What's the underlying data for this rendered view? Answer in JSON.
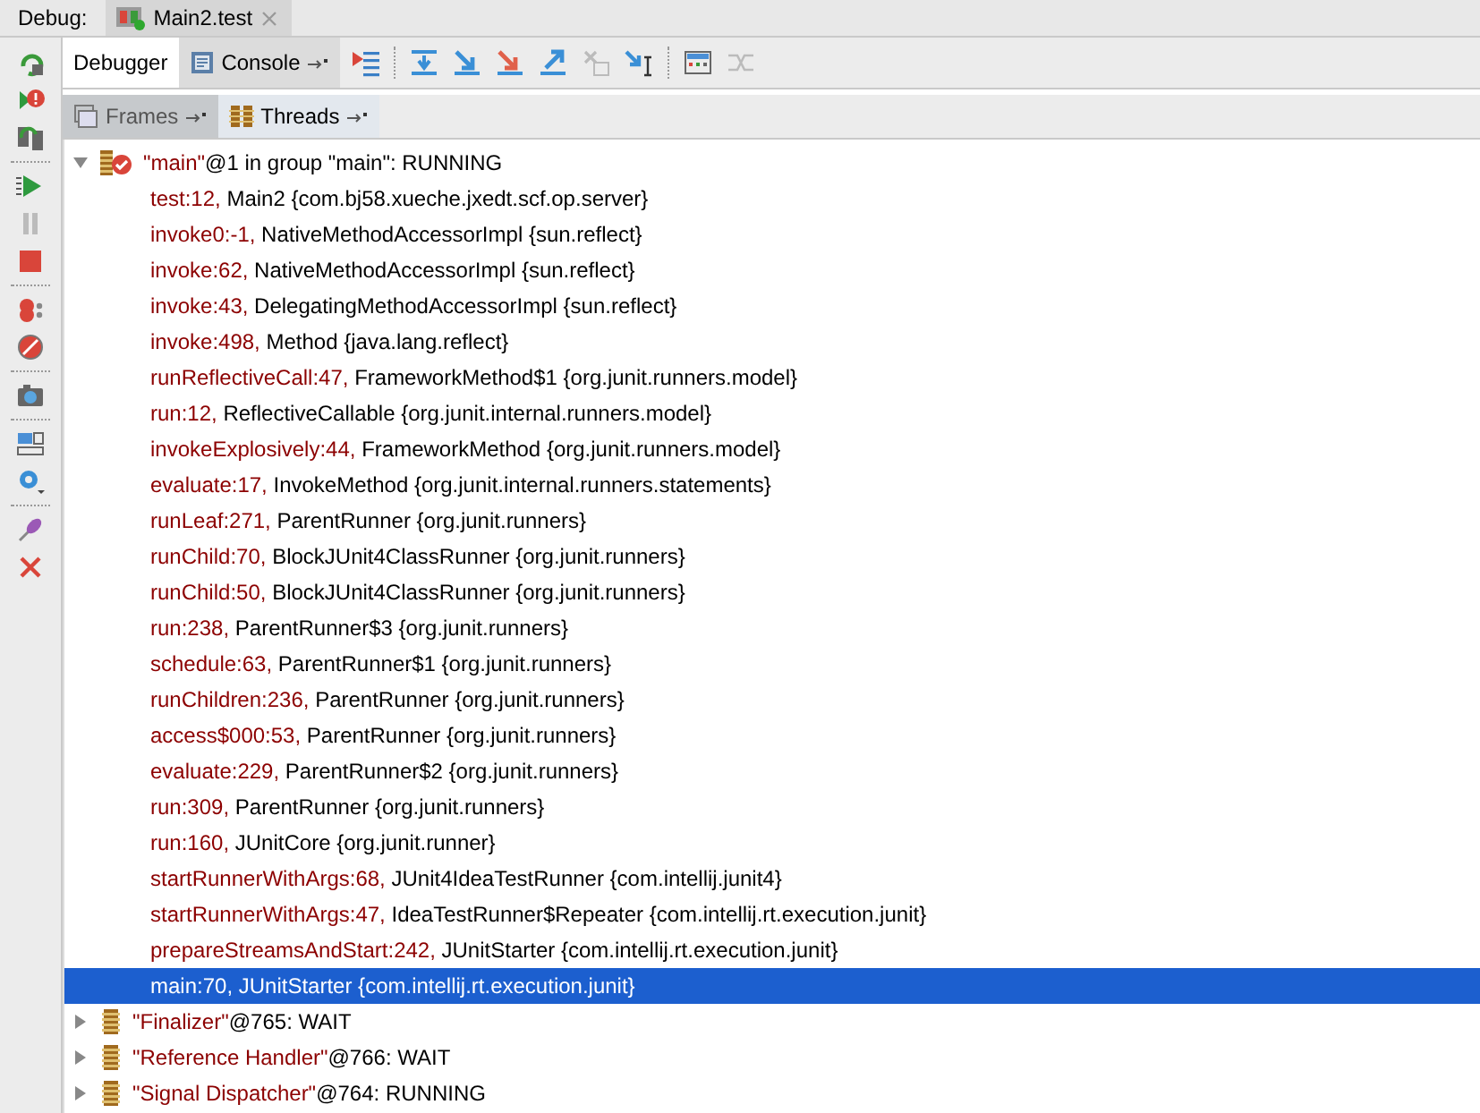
{
  "header": {
    "label": "Debug:",
    "tab": {
      "title": "Main2.test",
      "closable": true
    }
  },
  "view_tabs": [
    {
      "label": "Debugger",
      "selected": true,
      "kind": "plain"
    },
    {
      "label": "Console",
      "selected": false,
      "kind": "console"
    }
  ],
  "sub_tabs": [
    {
      "label": "Frames",
      "selected": false,
      "kind": "frames"
    },
    {
      "label": "Threads",
      "selected": true,
      "kind": "threads"
    }
  ],
  "threads": [
    {
      "name": "\"main\"",
      "info": "@1 in group \"main\": RUNNING",
      "expanded": true,
      "kind": "current",
      "frames": [
        {
          "location": "test:12,",
          "owner": "Main2 {com.bj58.xueche.jxedt.scf.op.server}",
          "selected": false
        },
        {
          "location": "invoke0:-1,",
          "owner": "NativeMethodAccessorImpl {sun.reflect}",
          "selected": false
        },
        {
          "location": "invoke:62,",
          "owner": "NativeMethodAccessorImpl {sun.reflect}",
          "selected": false
        },
        {
          "location": "invoke:43,",
          "owner": "DelegatingMethodAccessorImpl {sun.reflect}",
          "selected": false
        },
        {
          "location": "invoke:498,",
          "owner": "Method {java.lang.reflect}",
          "selected": false
        },
        {
          "location": "runReflectiveCall:47,",
          "owner": "FrameworkMethod$1 {org.junit.runners.model}",
          "selected": false
        },
        {
          "location": "run:12,",
          "owner": "ReflectiveCallable {org.junit.internal.runners.model}",
          "selected": false
        },
        {
          "location": "invokeExplosively:44,",
          "owner": "FrameworkMethod {org.junit.runners.model}",
          "selected": false
        },
        {
          "location": "evaluate:17,",
          "owner": "InvokeMethod {org.junit.internal.runners.statements}",
          "selected": false
        },
        {
          "location": "runLeaf:271,",
          "owner": "ParentRunner {org.junit.runners}",
          "selected": false
        },
        {
          "location": "runChild:70,",
          "owner": "BlockJUnit4ClassRunner {org.junit.runners}",
          "selected": false
        },
        {
          "location": "runChild:50,",
          "owner": "BlockJUnit4ClassRunner {org.junit.runners}",
          "selected": false
        },
        {
          "location": "run:238,",
          "owner": "ParentRunner$3 {org.junit.runners}",
          "selected": false
        },
        {
          "location": "schedule:63,",
          "owner": "ParentRunner$1 {org.junit.runners}",
          "selected": false
        },
        {
          "location": "runChildren:236,",
          "owner": "ParentRunner {org.junit.runners}",
          "selected": false
        },
        {
          "location": "access$000:53,",
          "owner": "ParentRunner {org.junit.runners}",
          "selected": false
        },
        {
          "location": "evaluate:229,",
          "owner": "ParentRunner$2 {org.junit.runners}",
          "selected": false
        },
        {
          "location": "run:309,",
          "owner": "ParentRunner {org.junit.runners}",
          "selected": false
        },
        {
          "location": "run:160,",
          "owner": "JUnitCore {org.junit.runner}",
          "selected": false
        },
        {
          "location": "startRunnerWithArgs:68,",
          "owner": "JUnit4IdeaTestRunner {com.intellij.junit4}",
          "selected": false
        },
        {
          "location": "startRunnerWithArgs:47,",
          "owner": "IdeaTestRunner$Repeater {com.intellij.rt.execution.junit}",
          "selected": false
        },
        {
          "location": "prepareStreamsAndStart:242,",
          "owner": "JUnitStarter {com.intellij.rt.execution.junit}",
          "selected": false
        },
        {
          "location": "main:70,",
          "owner": "JUnitStarter {com.intellij.rt.execution.junit}",
          "selected": true
        }
      ]
    },
    {
      "name": "\"Finalizer\"",
      "info": "@765: WAIT",
      "expanded": false,
      "kind": "other"
    },
    {
      "name": "\"Reference Handler\"",
      "info": "@766: WAIT",
      "expanded": false,
      "kind": "other"
    },
    {
      "name": "\"Signal Dispatcher\"",
      "info": "@764: RUNNING",
      "expanded": false,
      "kind": "other"
    }
  ]
}
